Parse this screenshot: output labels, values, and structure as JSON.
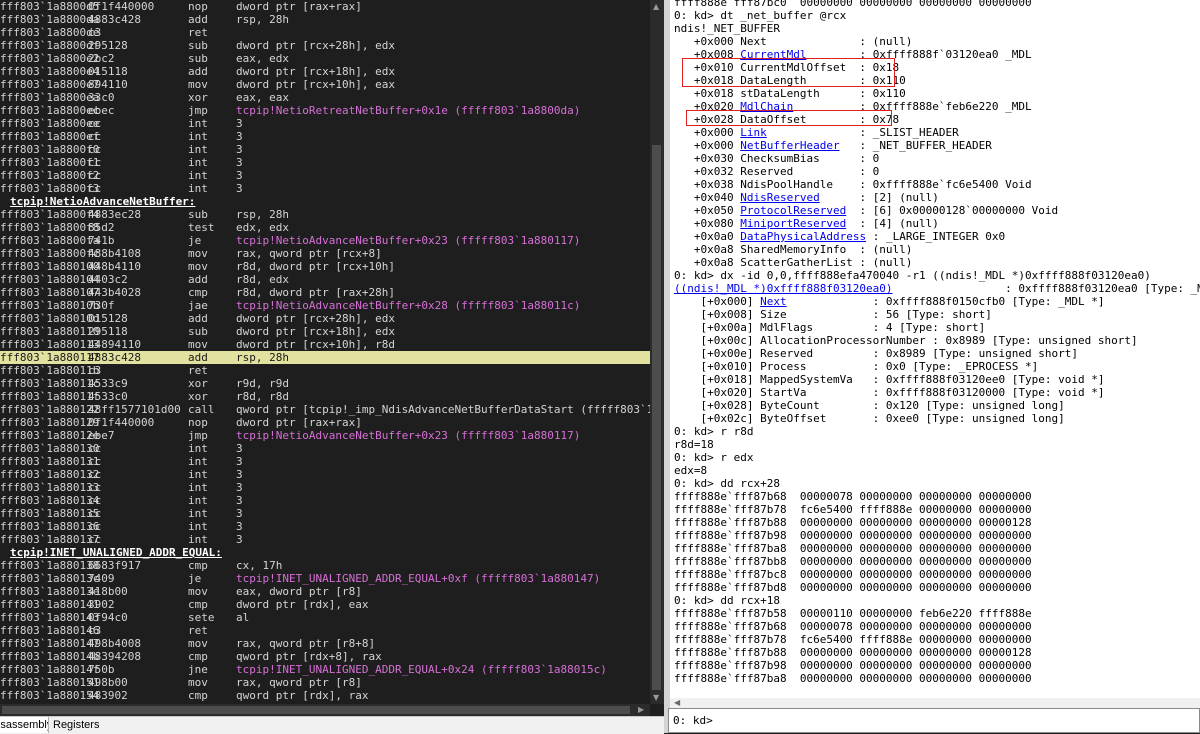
{
  "disassembly": {
    "lines": [
      {
        "addr": "fff803`1a8800d5",
        "bytes": "0f1f440000",
        "mn": "nop",
        "op": "dword ptr [rax+rax]"
      },
      {
        "addr": "fff803`1a8800da",
        "bytes": "4883c428",
        "mn": "add",
        "op": "rsp, 28h"
      },
      {
        "addr": "fff803`1a8800de",
        "bytes": "c3",
        "mn": "ret",
        "op": ""
      },
      {
        "addr": "fff803`1a8800df",
        "bytes": "295128",
        "mn": "sub",
        "op": "dword ptr [rcx+28h], edx"
      },
      {
        "addr": "fff803`1a8800e2",
        "bytes": "2bc2",
        "mn": "sub",
        "op": "eax, edx"
      },
      {
        "addr": "fff803`1a8800e4",
        "bytes": "015118",
        "mn": "add",
        "op": "dword ptr [rcx+18h], edx"
      },
      {
        "addr": "fff803`1a8800e7",
        "bytes": "894110",
        "mn": "mov",
        "op": "dword ptr [rcx+10h], eax"
      },
      {
        "addr": "fff803`1a8800ea",
        "bytes": "33c0",
        "mn": "xor",
        "op": "eax, eax"
      },
      {
        "addr": "fff803`1a8800ec",
        "bytes": "ebec",
        "mn": "jmp",
        "op": "tcpip!NetioRetreatNetBuffer+0x1e (fffff803`1a8800da)",
        "link": true
      },
      {
        "addr": "fff803`1a8800ee",
        "bytes": "cc",
        "mn": "int",
        "op": "3"
      },
      {
        "addr": "fff803`1a8800ef",
        "bytes": "cc",
        "mn": "int",
        "op": "3"
      },
      {
        "addr": "fff803`1a8800f0",
        "bytes": "cc",
        "mn": "int",
        "op": "3"
      },
      {
        "addr": "fff803`1a8800f1",
        "bytes": "cc",
        "mn": "int",
        "op": "3"
      },
      {
        "addr": "fff803`1a8800f2",
        "bytes": "cc",
        "mn": "int",
        "op": "3"
      },
      {
        "addr": "fff803`1a8800f3",
        "bytes": "cc",
        "mn": "int",
        "op": "3"
      },
      {
        "label": "tcpip!NetioAdvanceNetBuffer:"
      },
      {
        "addr": "fff803`1a8800f4",
        "bytes": "4883ec28",
        "mn": "sub",
        "op": "rsp, 28h"
      },
      {
        "addr": "fff803`1a8800f8",
        "bytes": "85d2",
        "mn": "test",
        "op": "edx, edx"
      },
      {
        "addr": "fff803`1a8800fa",
        "bytes": "741b",
        "mn": "je",
        "op": "tcpip!NetioAdvanceNetBuffer+0x23 (fffff803`1a880117)",
        "link": true
      },
      {
        "addr": "fff803`1a8800fc",
        "bytes": "488b4108",
        "mn": "mov",
        "op": "rax, qword ptr [rcx+8]"
      },
      {
        "addr": "fff803`1a880100",
        "bytes": "448b4110",
        "mn": "mov",
        "op": "r8d, dword ptr [rcx+10h]"
      },
      {
        "addr": "fff803`1a880104",
        "bytes": "4403c2",
        "mn": "add",
        "op": "r8d, edx"
      },
      {
        "addr": "fff803`1a880107",
        "bytes": "443b4028",
        "mn": "cmp",
        "op": "r8d, dword ptr [rax+28h]"
      },
      {
        "addr": "fff803`1a88010b",
        "bytes": "730f",
        "mn": "jae",
        "op": "tcpip!NetioAdvanceNetBuffer+0x28 (fffff803`1a88011c)",
        "link": true
      },
      {
        "addr": "fff803`1a88010d",
        "bytes": "015128",
        "mn": "add",
        "op": "dword ptr [rcx+28h], edx"
      },
      {
        "addr": "fff803`1a880110",
        "bytes": "295118",
        "mn": "sub",
        "op": "dword ptr [rcx+18h], edx"
      },
      {
        "addr": "fff803`1a880113",
        "bytes": "44894110",
        "mn": "mov",
        "op": "dword ptr [rcx+10h], r8d"
      },
      {
        "addr": "fff803`1a880117",
        "bytes": "4883c428",
        "mn": "add",
        "op": "rsp, 28h",
        "hl": true
      },
      {
        "addr": "fff803`1a88011b",
        "bytes": "c3",
        "mn": "ret",
        "op": ""
      },
      {
        "addr": "fff803`1a88011c",
        "bytes": "4533c9",
        "mn": "xor",
        "op": "r9d, r9d"
      },
      {
        "addr": "fff803`1a88011f",
        "bytes": "4533c0",
        "mn": "xor",
        "op": "r8d, r8d"
      },
      {
        "addr": "fff803`1a880122",
        "bytes": "48ff1577101d00",
        "mn": "call",
        "op": "qword ptr [tcpip!_imp_NdisAdvanceNetBufferDataStart (fffff803`1aa511"
      },
      {
        "addr": "fff803`1a880129",
        "bytes": "0f1f440000",
        "mn": "nop",
        "op": "dword ptr [rax+rax]"
      },
      {
        "addr": "fff803`1a88012e",
        "bytes": "ebe7",
        "mn": "jmp",
        "op": "tcpip!NetioAdvanceNetBuffer+0x23 (fffff803`1a880117)",
        "link": true
      },
      {
        "addr": "fff803`1a880130",
        "bytes": "cc",
        "mn": "int",
        "op": "3"
      },
      {
        "addr": "fff803`1a880131",
        "bytes": "cc",
        "mn": "int",
        "op": "3"
      },
      {
        "addr": "fff803`1a880132",
        "bytes": "cc",
        "mn": "int",
        "op": "3"
      },
      {
        "addr": "fff803`1a880133",
        "bytes": "cc",
        "mn": "int",
        "op": "3"
      },
      {
        "addr": "fff803`1a880134",
        "bytes": "cc",
        "mn": "int",
        "op": "3"
      },
      {
        "addr": "fff803`1a880135",
        "bytes": "cc",
        "mn": "int",
        "op": "3"
      },
      {
        "addr": "fff803`1a880136",
        "bytes": "cc",
        "mn": "int",
        "op": "3"
      },
      {
        "addr": "fff803`1a880137",
        "bytes": "cc",
        "mn": "int",
        "op": "3"
      },
      {
        "label": "tcpip!INET_UNALIGNED_ADDR_EQUAL:"
      },
      {
        "addr": "fff803`1a880138",
        "bytes": "6683f917",
        "mn": "cmp",
        "op": "cx, 17h"
      },
      {
        "addr": "fff803`1a88013c",
        "bytes": "7409",
        "mn": "je",
        "op": "tcpip!INET_UNALIGNED_ADDR_EQUAL+0xf (fffff803`1a880147)",
        "link": true
      },
      {
        "addr": "fff803`1a88013e",
        "bytes": "418b00",
        "mn": "mov",
        "op": "eax, dword ptr [r8]"
      },
      {
        "addr": "fff803`1a880141",
        "bytes": "3902",
        "mn": "cmp",
        "op": "dword ptr [rdx], eax"
      },
      {
        "addr": "fff803`1a880143",
        "bytes": "0f94c0",
        "mn": "sete",
        "op": "al"
      },
      {
        "addr": "fff803`1a880146",
        "bytes": "c3",
        "mn": "ret",
        "op": ""
      },
      {
        "addr": "fff803`1a880147",
        "bytes": "498b4008",
        "mn": "mov",
        "op": "rax, qword ptr [r8+8]"
      },
      {
        "addr": "fff803`1a88014b",
        "bytes": "48394208",
        "mn": "cmp",
        "op": "qword ptr [rdx+8], rax"
      },
      {
        "addr": "fff803`1a88014f",
        "bytes": "750b",
        "mn": "jne",
        "op": "tcpip!INET_UNALIGNED_ADDR_EQUAL+0x24 (fffff803`1a88015c)",
        "link": true
      },
      {
        "addr": "fff803`1a880151",
        "bytes": "498b00",
        "mn": "mov",
        "op": "rax, qword ptr [r8]"
      },
      {
        "addr": "fff803`1a880154",
        "bytes": "483902",
        "mn": "cmp",
        "op": "qword ptr [rdx], rax"
      }
    ]
  },
  "tabs": {
    "disassembly": "Disassembly",
    "registers": "Registers"
  },
  "command": {
    "lines": [
      [
        {
          "t": "ffff888e`fff87bc0  00000000 00000000 00000000 00000000"
        }
      ],
      [
        {
          "t": "0: kd> dt _net_buffer @rcx"
        }
      ],
      [
        {
          "t": "ndis!_NET_BUFFER"
        }
      ],
      [
        {
          "t": "   +0x000 Next              : (null)"
        }
      ],
      [
        {
          "t": "   +0x008 "
        },
        {
          "t": "CurrentMdl",
          "link": true
        },
        {
          "t": "        : 0xffff888f`03120ea0 _MDL"
        }
      ],
      [
        {
          "t": "   +0x010 CurrentMdlOffset  : 0x18"
        }
      ],
      [
        {
          "t": "   +0x018 DataLength        : 0x110"
        }
      ],
      [
        {
          "t": "   +0x018 stDataLength      : 0x110"
        }
      ],
      [
        {
          "t": "   +0x020 "
        },
        {
          "t": "MdlChain",
          "link": true
        },
        {
          "t": "          : 0xffff888e`feb6e220 _MDL"
        }
      ],
      [
        {
          "t": "   +0x028 DataOffset        : 0x78"
        }
      ],
      [
        {
          "t": "   +0x000 "
        },
        {
          "t": "Link",
          "link": true
        },
        {
          "t": "              : _SLIST_HEADER"
        }
      ],
      [
        {
          "t": "   +0x000 "
        },
        {
          "t": "NetBufferHeader",
          "link": true
        },
        {
          "t": "   : _NET_BUFFER_HEADER"
        }
      ],
      [
        {
          "t": "   +0x030 ChecksumBias      : 0"
        }
      ],
      [
        {
          "t": "   +0x032 Reserved          : 0"
        }
      ],
      [
        {
          "t": "   +0x038 NdisPoolHandle    : 0xffff888e`fc6e5400 Void"
        }
      ],
      [
        {
          "t": "   +0x040 "
        },
        {
          "t": "NdisReserved",
          "link": true
        },
        {
          "t": "      : [2] (null)"
        }
      ],
      [
        {
          "t": "   +0x050 "
        },
        {
          "t": "ProtocolReserved",
          "link": true
        },
        {
          "t": "  : [6] 0x00000128`00000000 Void"
        }
      ],
      [
        {
          "t": "   +0x080 "
        },
        {
          "t": "MiniportReserved",
          "link": true
        },
        {
          "t": "  : [4] (null)"
        }
      ],
      [
        {
          "t": "   +0x0a0 "
        },
        {
          "t": "DataPhysicalAddress",
          "link": true
        },
        {
          "t": " : _LARGE_INTEGER 0x0"
        }
      ],
      [
        {
          "t": "   +0x0a8 SharedMemoryInfo  : (null)"
        }
      ],
      [
        {
          "t": "   +0x0a8 ScatterGatherList : (null)"
        }
      ],
      [
        {
          "t": "0: kd> dx -id 0,0,ffff888efa470040 -r1 ((ndis!_MDL *)0xffff888f03120ea0)"
        }
      ],
      [
        {
          "t": "((ndis!_MDL *)0xffff888f03120ea0)",
          "link": true
        },
        {
          "t": "                 : 0xffff888f03120ea0 [Type: _MDL *]"
        }
      ],
      [
        {
          "t": "    [+0x000] "
        },
        {
          "t": "Next",
          "link": true
        },
        {
          "t": "             : 0xffff888f0150cfb0 [Type: _MDL *]"
        }
      ],
      [
        {
          "t": "    [+0x008] Size             : 56 [Type: short]"
        }
      ],
      [
        {
          "t": "    [+0x00a] MdlFlags         : 4 [Type: short]"
        }
      ],
      [
        {
          "t": "    [+0x00c] AllocationProcessorNumber : 0x8989 [Type: unsigned short]"
        }
      ],
      [
        {
          "t": "    [+0x00e] Reserved         : 0x8989 [Type: unsigned short]"
        }
      ],
      [
        {
          "t": "    [+0x010] Process          : 0x0 [Type: _EPROCESS *]"
        }
      ],
      [
        {
          "t": "    [+0x018] MappedSystemVa   : 0xffff888f03120ee0 [Type: void *]"
        }
      ],
      [
        {
          "t": "    [+0x020] StartVa          : 0xffff888f03120000 [Type: void *]"
        }
      ],
      [
        {
          "t": "    [+0x028] ByteCount        : 0x120 [Type: unsigned long]"
        }
      ],
      [
        {
          "t": "    [+0x02c] ByteOffset       : 0xee0 [Type: unsigned long]"
        }
      ],
      [
        {
          "t": "0: kd> r r8d"
        }
      ],
      [
        {
          "t": "r8d=18"
        }
      ],
      [
        {
          "t": "0: kd> r edx"
        }
      ],
      [
        {
          "t": "edx=8"
        }
      ],
      [
        {
          "t": "0: kd> dd rcx+28"
        }
      ],
      [
        {
          "t": "ffff888e`fff87b68  00000078 00000000 00000000 00000000"
        }
      ],
      [
        {
          "t": "ffff888e`fff87b78  fc6e5400 ffff888e 00000000 00000000"
        }
      ],
      [
        {
          "t": "ffff888e`fff87b88  00000000 00000000 00000000 00000128"
        }
      ],
      [
        {
          "t": "ffff888e`fff87b98  00000000 00000000 00000000 00000000"
        }
      ],
      [
        {
          "t": "ffff888e`fff87ba8  00000000 00000000 00000000 00000000"
        }
      ],
      [
        {
          "t": "ffff888e`fff87bb8  00000000 00000000 00000000 00000000"
        }
      ],
      [
        {
          "t": "ffff888e`fff87bc8  00000000 00000000 00000000 00000000"
        }
      ],
      [
        {
          "t": "ffff888e`fff87bd8  00000000 00000000 00000000 00000000"
        }
      ],
      [
        {
          "t": "0: kd> dd rcx+18"
        }
      ],
      [
        {
          "t": "ffff888e`fff87b58  00000110 00000000 feb6e220 ffff888e"
        }
      ],
      [
        {
          "t": "ffff888e`fff87b68  00000078 00000000 00000000 00000000"
        }
      ],
      [
        {
          "t": "ffff888e`fff87b78  fc6e5400 ffff888e 00000000 00000000"
        }
      ],
      [
        {
          "t": "ffff888e`fff87b88  00000000 00000000 00000000 00000128"
        }
      ],
      [
        {
          "t": "ffff888e`fff87b98  00000000 00000000 00000000 00000000"
        }
      ],
      [
        {
          "t": "ffff888e`fff87ba8  00000000 00000000 00000000 00000000"
        }
      ]
    ],
    "prompt": "0: kd>",
    "input_value": "",
    "input_placeholder": ""
  },
  "colors": {
    "highlight_box": "#e02020",
    "current_line": "#e1e1a0",
    "link_purple": "#d670d6",
    "link_blue": "#0000ee"
  },
  "icons": [
    "scroll-up-arrow-icon",
    "scroll-down-arrow-icon",
    "scroll-left-arrow-icon",
    "scroll-right-arrow-icon"
  ]
}
